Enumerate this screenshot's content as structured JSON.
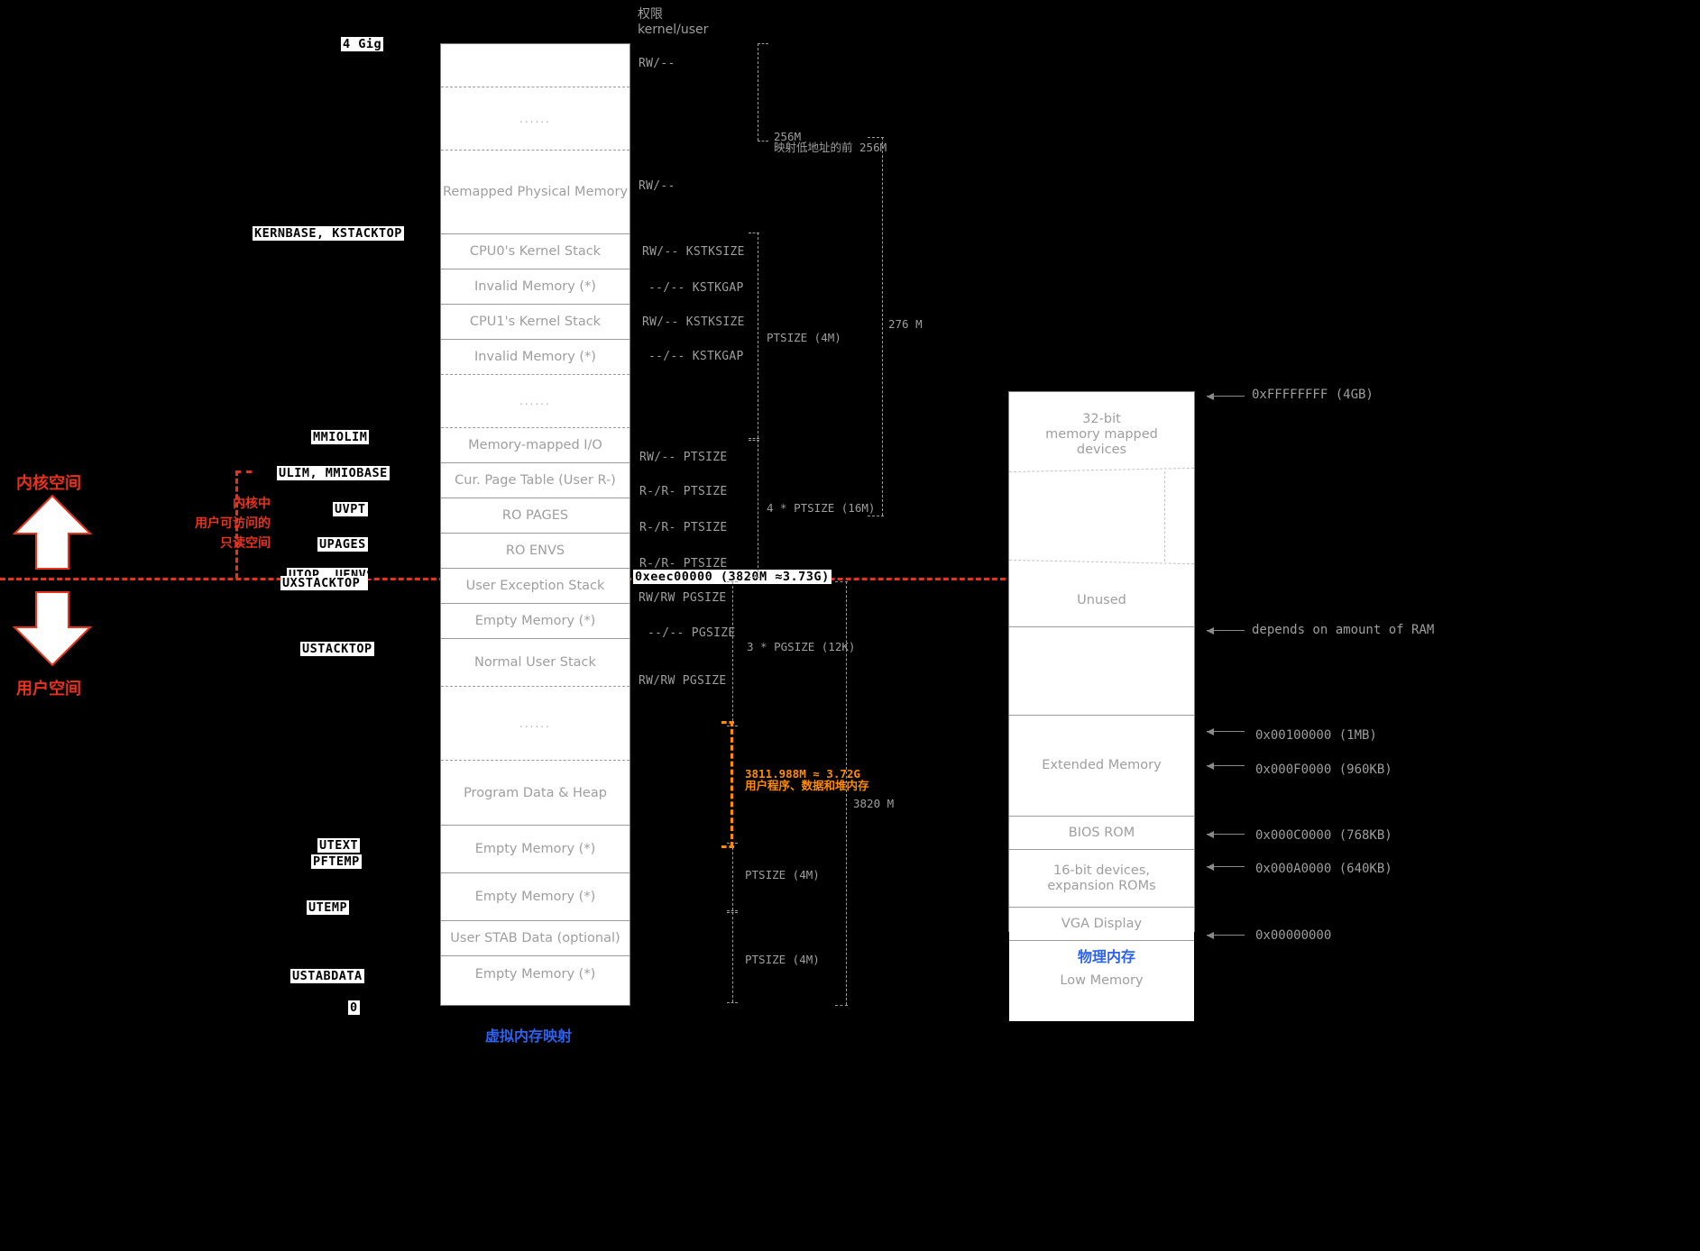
{
  "header": {
    "perm_title_cn": "权限",
    "perm_title_en": "kernel/user"
  },
  "left_axis": {
    "kernel_space": "内核空间",
    "user_space": "用户空间",
    "readonly_note": "内核中\n用户可访问的\n只读空间",
    "readonly_note_l1": "内核中",
    "readonly_note_l2": "用户可访问的",
    "readonly_note_l3": "只读空间"
  },
  "symbols": [
    {
      "name": "four-gig",
      "label": "4 Gig"
    },
    {
      "name": "kernbase",
      "label": "KERNBASE, KSTACKTOP"
    },
    {
      "name": "mmiolim",
      "label": "MMIOLIM"
    },
    {
      "name": "ulim",
      "label": "ULIM, MMIOBASE"
    },
    {
      "name": "uvpt",
      "label": "UVPT"
    },
    {
      "name": "upages",
      "label": "UPAGES"
    },
    {
      "name": "utop",
      "label": "UTOP, UENVS"
    },
    {
      "name": "uxstacktop",
      "label": "UXSTACKTOP -/"
    },
    {
      "name": "ustacktop",
      "label": "USTACKTOP"
    },
    {
      "name": "utext",
      "label": "UTEXT"
    },
    {
      "name": "pftemp",
      "label": "PFTEMP"
    },
    {
      "name": "utemp",
      "label": "UTEMP"
    },
    {
      "name": "ustabdata",
      "label": "USTABDATA"
    },
    {
      "name": "zero",
      "label": "0"
    }
  ],
  "virtual_memory": {
    "caption": "虚拟内存映射",
    "rows": [
      {
        "label": "",
        "perm": "RW/--"
      },
      {
        "label": "......",
        "perm": ""
      },
      {
        "label": "Remapped Physical Memory",
        "perm": "RW/--"
      },
      {
        "label": "CPU0's Kernel Stack",
        "perm": "RW/-- KSTKSIZE"
      },
      {
        "label": "Invalid Memory (*)",
        "perm": "--/-- KSTKGAP"
      },
      {
        "label": "CPU1's Kernel Stack",
        "perm": "RW/-- KSTKSIZE"
      },
      {
        "label": "Invalid Memory (*)",
        "perm": "--/-- KSTKGAP"
      },
      {
        "label": "......",
        "perm": ""
      },
      {
        "label": "Memory-mapped I/O",
        "perm": "RW/-- PTSIZE"
      },
      {
        "label": "Cur. Page Table (User R-)",
        "perm": "R-/R- PTSIZE"
      },
      {
        "label": "RO PAGES",
        "perm": "R-/R- PTSIZE"
      },
      {
        "label": "RO ENVS",
        "perm": "R-/R- PTSIZE"
      },
      {
        "label": "User Exception Stack",
        "perm": "RW/RW PGSIZE"
      },
      {
        "label": "Empty Memory (*)",
        "perm": "--/-- PGSIZE"
      },
      {
        "label": "Normal User Stack",
        "perm": "RW/RW PGSIZE"
      },
      {
        "label": "......",
        "perm": ""
      },
      {
        "label": "Program Data & Heap",
        "perm": ""
      },
      {
        "label": "Empty Memory (*)",
        "perm": ""
      },
      {
        "label": "Empty Memory (*)",
        "perm": ""
      },
      {
        "label": "User STAB Data (optional)",
        "perm": ""
      },
      {
        "label": "Empty Memory (*)",
        "perm": ""
      }
    ]
  },
  "bracket_notes": {
    "b256m": "256M",
    "b256m_cn": "映射低地址的前 256M",
    "b276m": "276 M",
    "ptsize4m_a": "PTSIZE (4M)",
    "ptsize16m": "4 * PTSIZE (16M)",
    "utop_addr": "0xeec00000 (3820M ≈3.73G)",
    "pgsize12k": "3 * PGSIZE (12K)",
    "b3820m": "3820 M",
    "ptsize4m_b": "PTSIZE (4M)",
    "ptsize4m_c": "PTSIZE (4M)",
    "orange_l1": "3811.988M ≈ 3.72G",
    "orange_l2": "用户程序、数据和堆内存"
  },
  "physical_memory": {
    "caption": "物理内存",
    "rows": [
      {
        "label": "32-bit\nmemory mapped\ndevices",
        "l1": "32-bit",
        "l2": "memory mapped",
        "l3": "devices"
      },
      {
        "label": "Unused"
      },
      {
        "label": "Extended Memory"
      },
      {
        "label": "BIOS ROM"
      },
      {
        "label": "16-bit devices,\nexpansion ROMs",
        "l1": "16-bit devices,",
        "l2": "expansion ROMs"
      },
      {
        "label": "VGA Display"
      },
      {
        "label": "Low Memory"
      }
    ],
    "addresses": [
      {
        "name": "addr-ffffffff",
        "label": "0xFFFFFFFF (4GB)"
      },
      {
        "name": "addr-ram",
        "label": "depends on amount of RAM"
      },
      {
        "name": "addr-00100000",
        "label": "0x00100000 (1MB)"
      },
      {
        "name": "addr-000f0000",
        "label": "0x000F0000 (960KB)"
      },
      {
        "name": "addr-000c0000",
        "label": "0x000C0000 (768KB)"
      },
      {
        "name": "addr-000a0000",
        "label": "0x000A0000 (640KB)"
      },
      {
        "name": "addr-00000000",
        "label": "0x00000000"
      }
    ]
  },
  "colors": {
    "red": "#e8321e",
    "orange": "#ff8c00",
    "blue": "#2b62f0",
    "gray": "#9e9e9e"
  }
}
